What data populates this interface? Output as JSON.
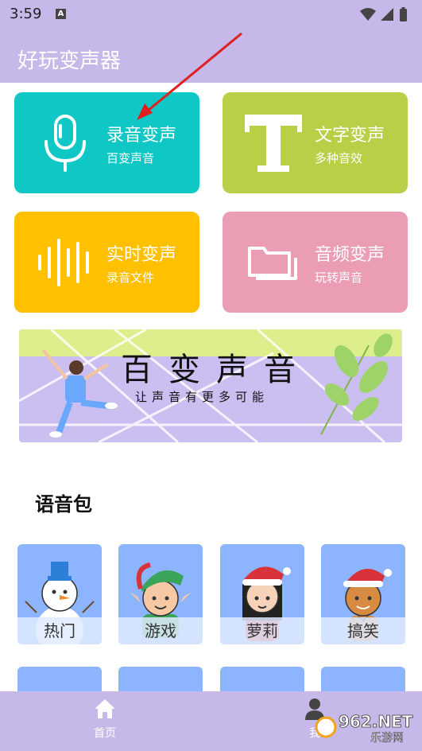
{
  "status": {
    "time": "3:59",
    "notification": "A"
  },
  "app": {
    "title": "好玩变声器"
  },
  "cards": [
    {
      "title": "录音变声",
      "subtitle": "百变声音",
      "color": "#0fc8c6"
    },
    {
      "title": "文字变声",
      "subtitle": "多种音效",
      "color": "#b8cf48"
    },
    {
      "title": "实时变声",
      "subtitle": "录音文件",
      "color": "#ffc000"
    },
    {
      "title": "音频变声",
      "subtitle": "玩转声音",
      "color": "#ea9db3"
    }
  ],
  "banner": {
    "heading": "百变声音",
    "subheading": "让声音有更多可能"
  },
  "voice_packs": {
    "title": "语音包",
    "items": [
      {
        "label": "热门",
        "icon": "snowman-icon"
      },
      {
        "label": "游戏",
        "icon": "elf-icon"
      },
      {
        "label": "萝莉",
        "icon": "girl-santa-icon"
      },
      {
        "label": "搞笑",
        "icon": "gingerbread-icon"
      }
    ]
  },
  "nav": {
    "home": "首页",
    "me": "我"
  },
  "watermark": {
    "text": "962.NET",
    "sub": "乐游网"
  }
}
